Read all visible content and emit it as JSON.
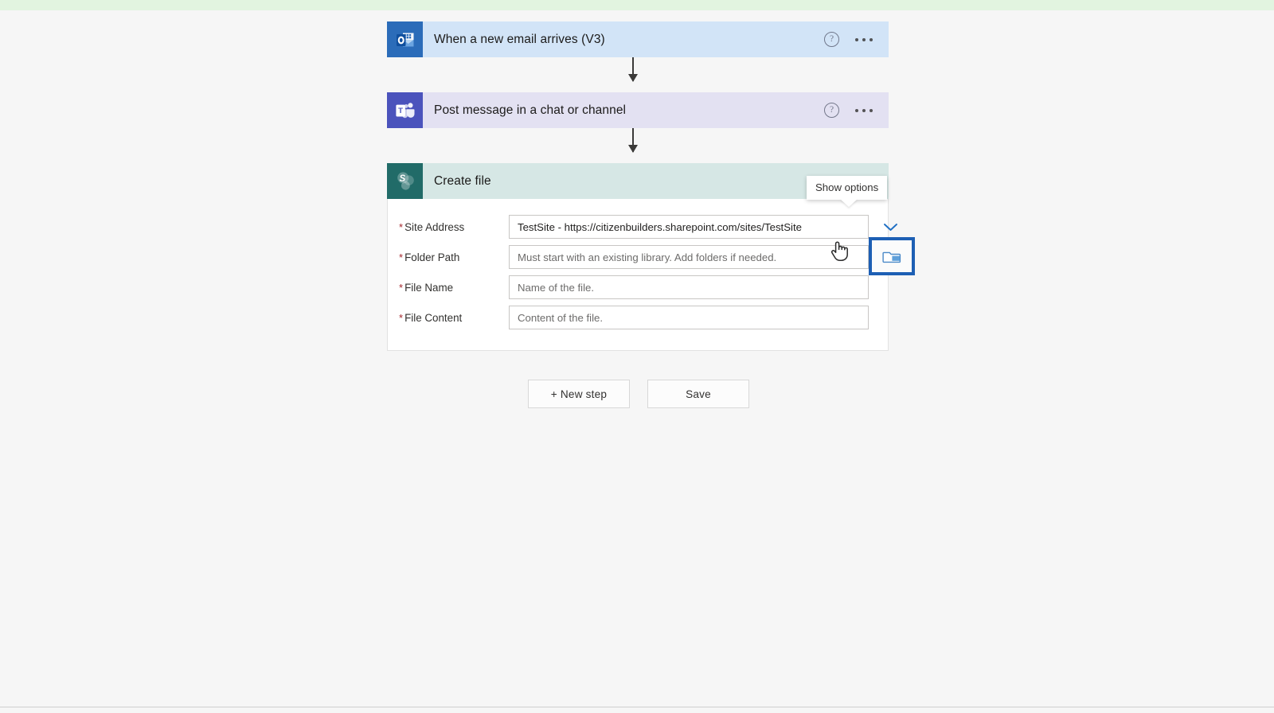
{
  "page": {
    "background_color": "#f6f6f6",
    "top_banner_color": "#e2f4e0"
  },
  "flow": {
    "steps": [
      {
        "id": "email-trigger",
        "title": "When a new email arrives (V3)",
        "icon": "outlook-icon",
        "header_color": "#d2e4f7",
        "icon_color": "#2b6cb9",
        "help_label": "?",
        "menu_label": "..."
      },
      {
        "id": "teams-action",
        "title": "Post message in a chat or channel",
        "icon": "teams-icon",
        "header_color": "#e3e1f2",
        "icon_color": "#4b53bc",
        "help_label": "?",
        "menu_label": "..."
      },
      {
        "id": "create-file",
        "title": "Create file",
        "icon": "sharepoint-icon",
        "header_color": "#d6e7e5",
        "icon_color": "#216b68",
        "help_label": "?",
        "menu_label": "..."
      }
    ]
  },
  "create_file_form": {
    "fields": [
      {
        "label": "Site Address",
        "required_marker": "*",
        "value": "TestSite - https://citizenbuilders.sharepoint.com/sites/TestSite",
        "placeholder": "",
        "control": "dropdown"
      },
      {
        "label": "Folder Path",
        "required_marker": "*",
        "value": "",
        "placeholder": "Must start with an existing library. Add folders if needed.",
        "control": "folder-picker"
      },
      {
        "label": "File Name",
        "required_marker": "*",
        "value": "",
        "placeholder": "Name of the file.",
        "control": "text"
      },
      {
        "label": "File Content",
        "required_marker": "*",
        "value": "",
        "placeholder": "Content of the file.",
        "control": "text"
      }
    ]
  },
  "tooltip": {
    "text": "Show options",
    "visible": true
  },
  "highlight": {
    "target": "folder-picker-button",
    "border_color": "#1d5fb4"
  },
  "footer": {
    "new_step_label": "+ New step",
    "save_label": "Save"
  }
}
